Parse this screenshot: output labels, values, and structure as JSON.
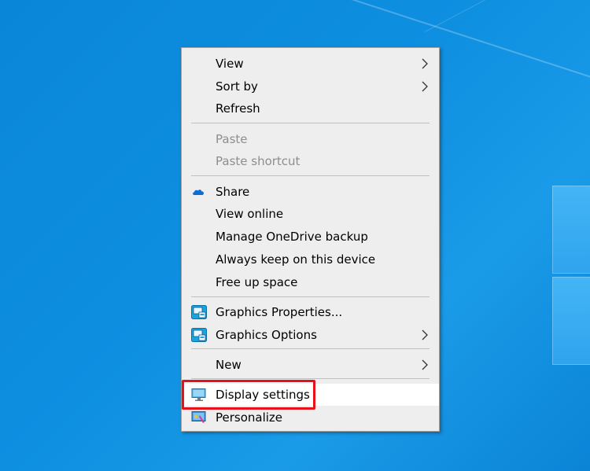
{
  "desktop": {
    "background_color": "#0e8fe0"
  },
  "context_menu": {
    "items": [
      {
        "label": "View",
        "has_submenu": true,
        "enabled": true
      },
      {
        "label": "Sort by",
        "has_submenu": true,
        "enabled": true
      },
      {
        "label": "Refresh",
        "has_submenu": false,
        "enabled": true
      },
      {
        "label": "Paste",
        "has_submenu": false,
        "enabled": false
      },
      {
        "label": "Paste shortcut",
        "has_submenu": false,
        "enabled": false
      },
      {
        "label": "Share",
        "icon": "onedrive-cloud-icon",
        "enabled": true
      },
      {
        "label": "View online",
        "enabled": true
      },
      {
        "label": "Manage OneDrive backup",
        "enabled": true
      },
      {
        "label": "Always keep on this device",
        "enabled": true
      },
      {
        "label": "Free up space",
        "enabled": true
      },
      {
        "label": "Graphics Properties...",
        "icon": "intel-graphics-icon",
        "enabled": true
      },
      {
        "label": "Graphics Options",
        "icon": "intel-graphics-icon",
        "has_submenu": true,
        "enabled": true
      },
      {
        "label": "New",
        "has_submenu": true,
        "enabled": true
      },
      {
        "label": "Display settings",
        "icon": "monitor-icon",
        "enabled": true,
        "highlighted": true
      },
      {
        "label": "Personalize",
        "icon": "personalize-icon",
        "enabled": true
      }
    ]
  },
  "annotation": {
    "highlight_color": "#e8101b",
    "target": "Display settings"
  }
}
